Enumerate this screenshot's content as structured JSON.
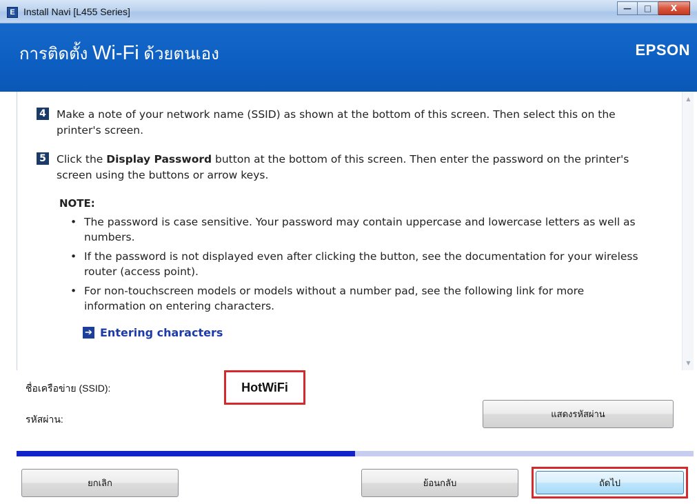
{
  "window": {
    "icon": "E",
    "title": "Install Navi [L455 Series]",
    "controls": {
      "minimize": "—",
      "maximize": "□",
      "close": "X"
    }
  },
  "header": {
    "title_thai_prefix": "การติดตั้ง",
    "title_wifi": "Wi-Fi",
    "title_thai_suffix": "ด้วยตนเอง",
    "brand": "EPSON",
    "background_color": "#0d5ec1"
  },
  "steps": [
    {
      "number": "4",
      "text": "Make a note of your network name (SSID) as shown at the bottom of this screen. Then select this on the printer's screen."
    },
    {
      "number": "5",
      "text_before": "Click the ",
      "bold": "Display Password",
      "text_after": " button at the bottom of this screen. Then enter the password on the printer's screen using the buttons or arrow keys."
    }
  ],
  "note": {
    "title": "NOTE:",
    "bullet": "•",
    "items": [
      "The password is case sensitive. Your password may contain uppercase and lowercase letters as well as numbers.",
      "If the password is not displayed even after clicking the button, see the documentation for your wireless router (access point).",
      "For non-touchscreen models or models without a number pad, see the following link for more information on entering characters."
    ]
  },
  "link": {
    "icon": "arrow-right-icon",
    "arrow": "➔",
    "label": "Entering characters",
    "color": "#1c3aa8"
  },
  "network": {
    "ssid_label": "ชื่อเครือข่าย (SSID):",
    "ssid_value": "HotWiFi",
    "password_label": "รหัสผ่าน:",
    "display_password_button": "แสดงรหัสผ่าน"
  },
  "progress": {
    "fraction": 0.5,
    "fill_color": "#1123c9",
    "track_color": "#c7cdef"
  },
  "footer": {
    "cancel_button": "ยกเลิก",
    "back_button": "ย้อนกลับ",
    "next_button": "ถัดไป"
  },
  "scrollbar": {
    "up": "▲",
    "down": "▼"
  },
  "highlight_color": "#d4292d"
}
